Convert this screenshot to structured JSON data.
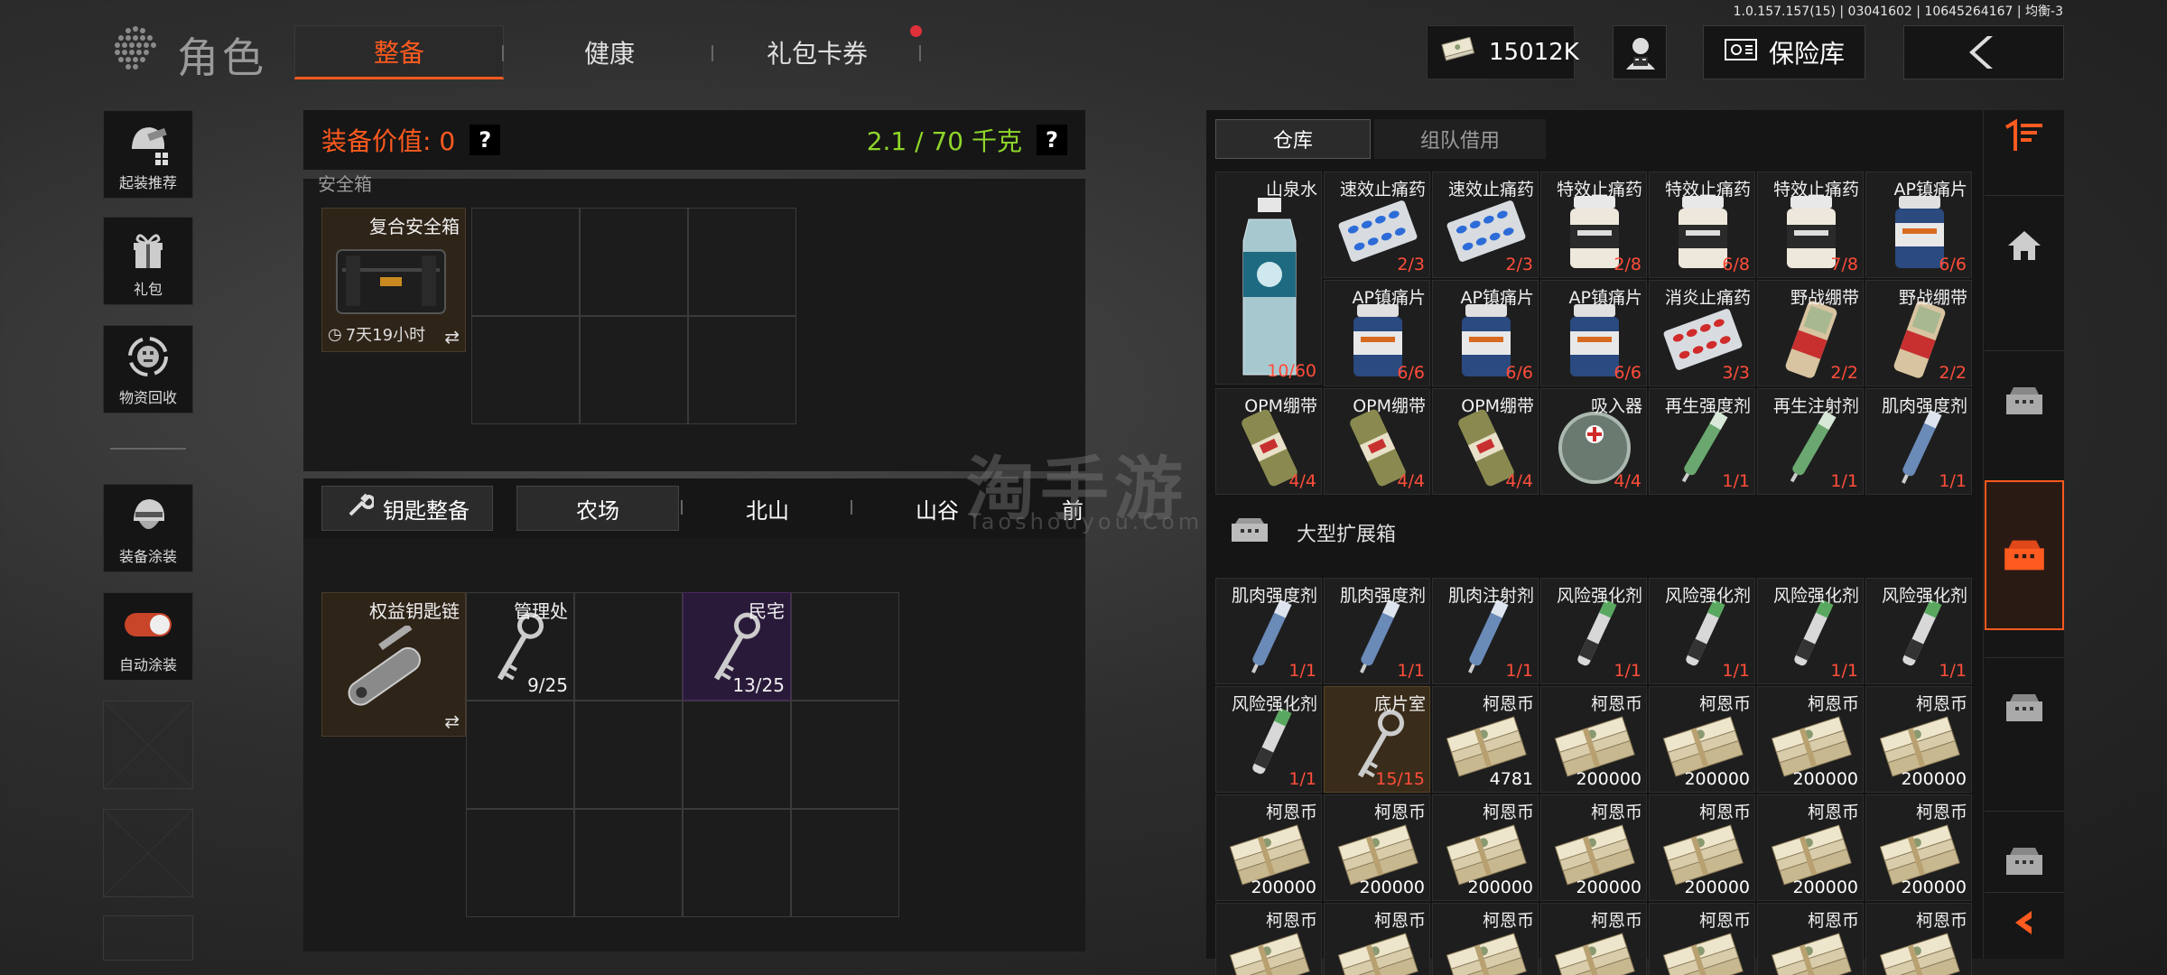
{
  "build_info": "1.0.157.157(15) | 03041602 | 10645264167 | 均衡-3",
  "header": {
    "title": "角色",
    "tabs": [
      {
        "label": "整备",
        "active": true
      },
      {
        "label": "健康",
        "active": false
      },
      {
        "label": "礼包卡券",
        "active": false,
        "notification": true
      }
    ],
    "currency": {
      "icon": "cash-stack-icon",
      "value": "15012K"
    },
    "vault_label": "保险库"
  },
  "sidebar": {
    "items": [
      {
        "label": "起装推荐",
        "icon": "helmet-recommend-icon"
      },
      {
        "label": "礼包",
        "icon": "gift-icon"
      },
      {
        "label": "物资回收",
        "icon": "recycle-icon"
      },
      {
        "label": "装备涂装",
        "icon": "helmet-paint-icon"
      },
      {
        "label": "自动涂装",
        "icon": "toggle-icon",
        "toggle_on": true
      }
    ]
  },
  "equip": {
    "value_label": "装备价值: 0",
    "weight_label": "2.1 / 70 千克",
    "help": "?"
  },
  "safe_box": {
    "heading": "安全箱",
    "item_name": "复合安全箱",
    "timer": "7天19小时"
  },
  "keys": {
    "organize_label": "钥匙整备",
    "tabs": [
      "农场",
      "北山",
      "山谷",
      "前"
    ],
    "keychain_name": "权益钥匙链",
    "items": [
      {
        "name": "管理处",
        "count": "9/25"
      },
      {
        "name": "民宅",
        "count": "13/25"
      }
    ]
  },
  "warehouse": {
    "tabs": [
      "仓库",
      "组队借用"
    ],
    "rows": [
      [
        {
          "name": "山泉水",
          "count": "10/60",
          "icon": "water-bottle-icon"
        },
        {
          "name": "速效止痛药",
          "count": "2/3",
          "icon": "pill-blister-icon"
        },
        {
          "name": "速效止痛药",
          "count": "2/3",
          "icon": "pill-blister-icon"
        },
        {
          "name": "特效止痛药",
          "count": "2/8",
          "icon": "white-pill-bottle-icon"
        },
        {
          "name": "特效止痛药",
          "count": "6/8",
          "icon": "white-pill-bottle-icon"
        },
        {
          "name": "特效止痛药",
          "count": "7/8",
          "icon": "white-pill-bottle-icon"
        },
        {
          "name": "AP镇痛片",
          "count": "6/6",
          "icon": "blue-pill-bottle-icon"
        }
      ],
      [
        null,
        {
          "name": "AP镇痛片",
          "count": "6/6",
          "icon": "blue-pill-bottle-icon"
        },
        {
          "name": "AP镇痛片",
          "count": "6/6",
          "icon": "blue-pill-bottle-icon"
        },
        {
          "name": "AP镇痛片",
          "count": "6/6",
          "icon": "blue-pill-bottle-icon"
        },
        {
          "name": "消炎止痛药",
          "count": "3/3",
          "icon": "red-pill-blister-icon"
        },
        {
          "name": "野战绷带",
          "count": "2/2",
          "icon": "field-bandage-icon"
        },
        {
          "name": "野战绷带",
          "count": "2/2",
          "icon": "field-bandage-icon"
        }
      ],
      [
        {
          "name": "OPM绷带",
          "count": "4/4",
          "icon": "opm-bandage-icon"
        },
        {
          "name": "OPM绷带",
          "count": "4/4",
          "icon": "opm-bandage-icon"
        },
        {
          "name": "OPM绷带",
          "count": "4/4",
          "icon": "opm-bandage-icon"
        },
        {
          "name": "吸入器",
          "count": "4/4",
          "icon": "inhaler-icon"
        },
        {
          "name": "再生强度剂",
          "count": "1/1",
          "icon": "green-injector-icon"
        },
        {
          "name": "再生注射剂",
          "count": "1/1",
          "icon": "green-injector-icon"
        },
        {
          "name": "肌肉强度剂",
          "count": "1/1",
          "icon": "blue-injector-icon"
        }
      ]
    ],
    "extension_label": "大型扩展箱",
    "ext_rows": [
      [
        {
          "name": "肌肉强度剂",
          "count": "1/1",
          "icon": "blue-injector-icon"
        },
        {
          "name": "肌肉强度剂",
          "count": "1/1",
          "icon": "blue-injector-icon"
        },
        {
          "name": "肌肉注射剂",
          "count": "1/1",
          "icon": "blue-injector-icon"
        },
        {
          "name": "风险强化剂",
          "count": "1/1",
          "icon": "gray-injector-icon"
        },
        {
          "name": "风险强化剂",
          "count": "1/1",
          "icon": "gray-injector-icon"
        },
        {
          "name": "风险强化剂",
          "count": "1/1",
          "icon": "gray-injector-icon"
        },
        {
          "name": "风险强化剂",
          "count": "1/1",
          "icon": "gray-injector-icon"
        }
      ],
      [
        {
          "name": "风险强化剂",
          "count": "1/1",
          "icon": "gray-injector-icon"
        },
        {
          "name": "底片室",
          "count": "15/15",
          "icon": "key-icon",
          "highlight": true
        },
        {
          "name": "柯恩币",
          "count": "4781",
          "icon": "cash-stack-icon"
        },
        {
          "name": "柯恩币",
          "count": "200000",
          "icon": "cash-stack-icon"
        },
        {
          "name": "柯恩币",
          "count": "200000",
          "icon": "cash-stack-icon"
        },
        {
          "name": "柯恩币",
          "count": "200000",
          "icon": "cash-stack-icon"
        },
        {
          "name": "柯恩币",
          "count": "200000",
          "icon": "cash-stack-icon"
        }
      ],
      [
        {
          "name": "柯恩币",
          "count": "200000",
          "icon": "cash-stack-icon"
        },
        {
          "name": "柯恩币",
          "count": "200000",
          "icon": "cash-stack-icon"
        },
        {
          "name": "柯恩币",
          "count": "200000",
          "icon": "cash-stack-icon"
        },
        {
          "name": "柯恩币",
          "count": "200000",
          "icon": "cash-stack-icon"
        },
        {
          "name": "柯恩币",
          "count": "200000",
          "icon": "cash-stack-icon"
        },
        {
          "name": "柯恩币",
          "count": "200000",
          "icon": "cash-stack-icon"
        },
        {
          "name": "柯恩币",
          "count": "200000",
          "icon": "cash-stack-icon"
        }
      ],
      [
        {
          "name": "柯恩币",
          "count": "",
          "icon": "cash-stack-icon"
        },
        {
          "name": "柯恩币",
          "count": "",
          "icon": "cash-stack-icon"
        },
        {
          "name": "柯恩币",
          "count": "",
          "icon": "cash-stack-icon"
        },
        {
          "name": "柯恩币",
          "count": "",
          "icon": "cash-stack-icon"
        },
        {
          "name": "柯恩币",
          "count": "",
          "icon": "cash-stack-icon"
        },
        {
          "name": "柯恩币",
          "count": "",
          "icon": "cash-stack-icon"
        },
        {
          "name": "柯恩币",
          "count": "",
          "icon": "cash-stack-icon"
        }
      ]
    ]
  },
  "rail": {
    "icons": [
      "sort-icon",
      "home-icon",
      "container-icon",
      "container-icon-active",
      "container-icon",
      "container-icon",
      "collapse-arrow-icon"
    ]
  },
  "watermark": {
    "main": "淘手游",
    "sub": "Taoshouyou.Com"
  },
  "colors": {
    "accent": "#ff5a1f",
    "weight": "#8fd62a",
    "count_red": "#ff4d3a"
  }
}
